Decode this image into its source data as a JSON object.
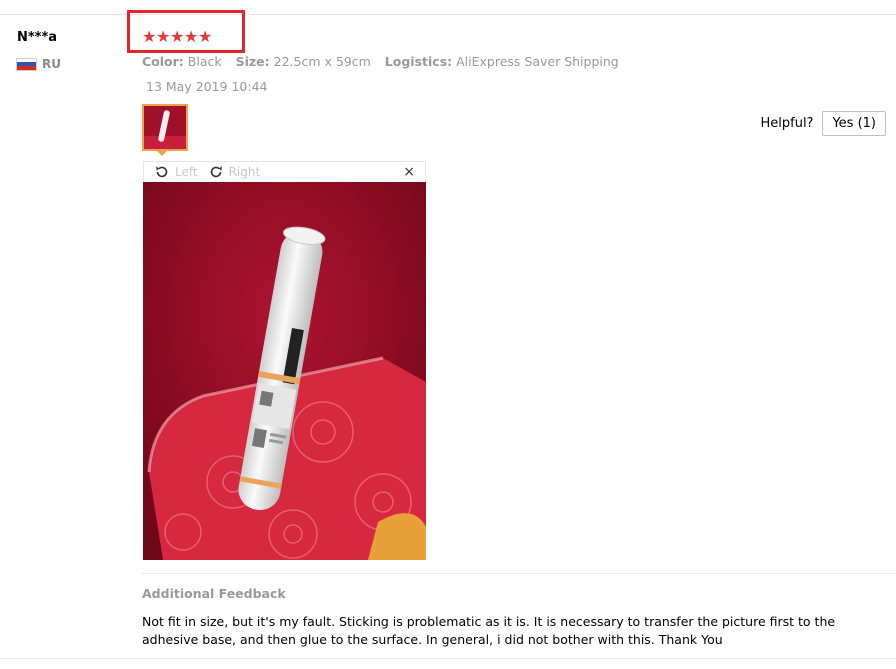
{
  "review": {
    "user_name": "N***a",
    "country_code": "RU",
    "flag_colors": [
      "#ffffff",
      "#2d56b5",
      "#d52b1e"
    ],
    "rating": 5,
    "stars": "★★★★★",
    "color_label": "Color:",
    "color_value": "Black",
    "size_label": "Size:",
    "size_value": "22.5cm x 59cm",
    "logistics_label": "Logistics:",
    "logistics_value": "AliExpress Saver Shipping",
    "date": "13 May 2019 10:44",
    "helpful_label": "Helpful?",
    "yes_button": "Yes (1)",
    "viewer": {
      "rotate_left": "Left",
      "rotate_right": "Right",
      "close": "×"
    },
    "additional_feedback_title": "Additional Feedback",
    "additional_feedback_text": "Not fit in size, but it's my fault. Sticking is problematic as it is. It is necessary to transfer the picture first to the adhesive base, and then glue to the surface. In general, i did not bother with this. Thank You"
  },
  "colors": {
    "highlight_box": "#e4262c",
    "star": "#e4393c",
    "thumb_border": "#f0a24a"
  }
}
